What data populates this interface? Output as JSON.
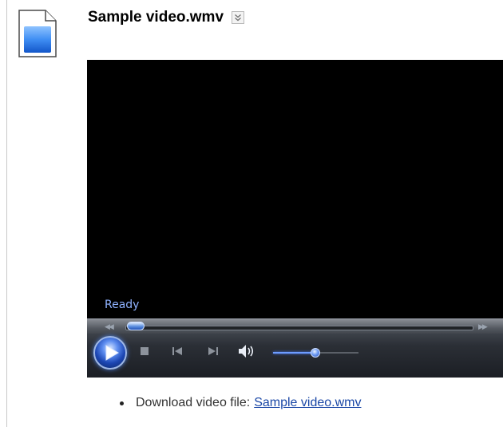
{
  "header": {
    "file_title": "Sample video.wmv",
    "file_icon": "document-icon",
    "expand_icon": "chevron-double-down-icon"
  },
  "player": {
    "status_text": "Ready",
    "seek_position": 0.0,
    "volume_level": 0.45,
    "controls": [
      "play-icon",
      "stop-icon",
      "previous-icon",
      "next-icon",
      "speaker-icon"
    ],
    "accent_color": "#4a7fff"
  },
  "download": {
    "label": "Download video file:",
    "link_text": "Sample video.wmv"
  }
}
